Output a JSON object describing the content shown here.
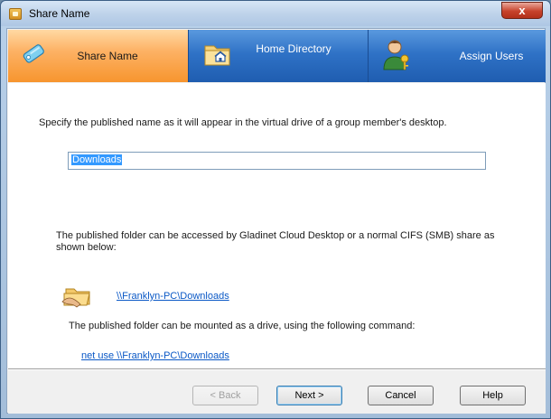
{
  "window": {
    "title": "Share Name",
    "close_label": "x"
  },
  "tabs": [
    {
      "label": "Share Name",
      "icon": "tag-icon",
      "active": true
    },
    {
      "label": "Home Directory",
      "icon": "folder-home-icon",
      "active": false
    },
    {
      "label": "Assign Users",
      "icon": "user-key-icon",
      "active": false
    }
  ],
  "content": {
    "instruction": "Specify the published name as it will appear in the virtual drive of a group member's desktop.",
    "share_name_value": "Downloads",
    "access_text": "The published folder can be accessed by Gladinet Cloud Desktop or a normal CIFS (SMB) share as shown below:",
    "unc_path": "\\\\Franklyn-PC\\Downloads",
    "mount_text": "The published folder can be mounted as a drive, using the following command:",
    "mount_command": "net use \\\\Franklyn-PC\\Downloads"
  },
  "buttons": {
    "back": "< Back",
    "next": "Next >",
    "cancel": "Cancel",
    "help": "Help"
  },
  "colors": {
    "tab_active": "#f7952e",
    "tab_inactive": "#2f72c6",
    "link": "#0a58c6"
  }
}
